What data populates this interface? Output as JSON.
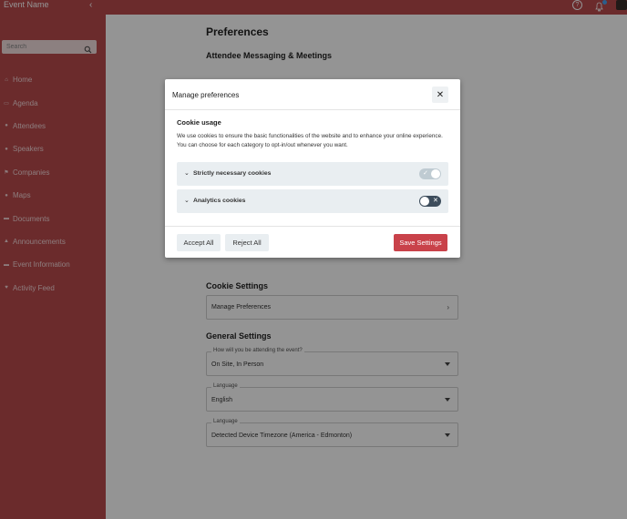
{
  "topbar": {
    "event_name": "Event Name",
    "collapse_glyph": "‹",
    "help_glyph": "?",
    "icons": [
      "help-icon",
      "bell-icon",
      "avatar"
    ]
  },
  "sidebar": {
    "search_placeholder": "Search",
    "items": [
      {
        "label": "Home",
        "icon": "home-icon",
        "glyph": "⌂"
      },
      {
        "label": "Agenda",
        "icon": "calendar-icon",
        "glyph": "▭"
      },
      {
        "label": "Attendees",
        "icon": "attendees-icon",
        "glyph": "●"
      },
      {
        "label": "Speakers",
        "icon": "speakers-icon",
        "glyph": "●"
      },
      {
        "label": "Companies",
        "icon": "flag-icon",
        "glyph": "⚑"
      },
      {
        "label": "Maps",
        "icon": "map-pin-icon",
        "glyph": "●"
      },
      {
        "label": "Documents",
        "icon": "documents-icon",
        "glyph": "▬"
      },
      {
        "label": "Announcements",
        "icon": "bell-icon",
        "glyph": "▲"
      },
      {
        "label": "Event Information",
        "icon": "folder-icon",
        "glyph": "▬"
      },
      {
        "label": "Activity Feed",
        "icon": "heart-icon",
        "glyph": "♥"
      }
    ]
  },
  "main": {
    "page_title": "Preferences",
    "messaging_title": "Attendee Messaging & Meetings",
    "cookie_settings": {
      "title": "Cookie Settings",
      "manage_label": "Manage Preferences",
      "chevron": "›"
    },
    "general_settings": {
      "title": "General Settings",
      "attending": {
        "legend": "How will you be attending the event?",
        "value": "On Site, In Person"
      },
      "language": {
        "legend": "Language",
        "value": "English"
      },
      "timezone": {
        "legend": "Language",
        "value": "Detected Device Timezone (America - Edmonton)"
      }
    }
  },
  "modal": {
    "title": "Manage preferences",
    "close_glyph": "✕",
    "subtitle": "Cookie usage",
    "description": "We use cookies to ensure the basic functionalities of the website and to enhance your online experience. You can choose for each category to opt-in/out whenever you want.",
    "categories": [
      {
        "label": "Strictly necessary cookies",
        "enabled": true,
        "locked": true,
        "mark": "✓"
      },
      {
        "label": "Analytics cookies",
        "enabled": false,
        "locked": false,
        "mark": "✕"
      }
    ],
    "chevron": "⌄",
    "accept_all_label": "Accept All",
    "reject_all_label": "Reject All",
    "save_label": "Save Settings"
  },
  "colors": {
    "brand": "#b84a4d",
    "primary_button": "#c9424a",
    "toggle_off": "#3d4d5c",
    "toggle_locked": "#bfcbd2"
  }
}
